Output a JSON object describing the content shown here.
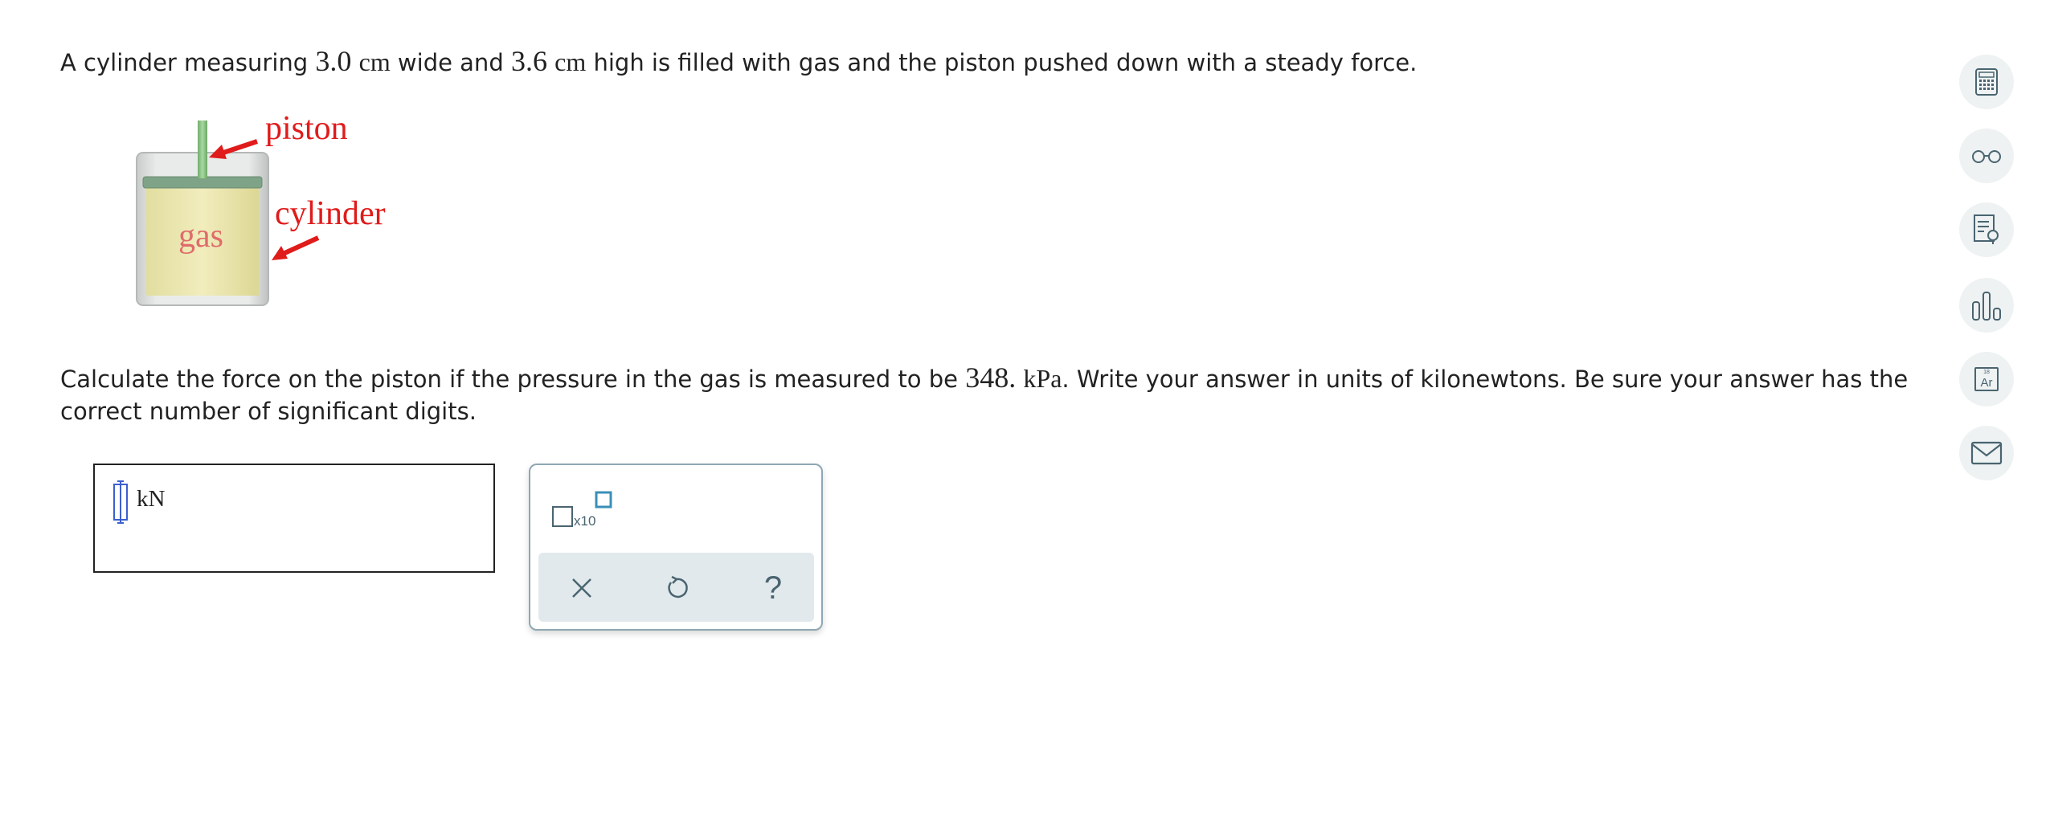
{
  "question": {
    "intro": {
      "part1": "A cylinder measuring ",
      "width_value": "3.0",
      "width_unit": "cm",
      "part2": " wide and ",
      "height_value": "3.6",
      "height_unit": "cm",
      "part3": " high is filled with gas and the piston pushed down with a steady force."
    },
    "prompt": {
      "part1": "Calculate the force on the piston if the pressure in the gas is measured to be ",
      "pressure_value": "348.",
      "pressure_unit": "kPa",
      "part2": ". Write your answer in units of kilonewtons. Be sure your answer has the correct number of significant digits."
    }
  },
  "figure": {
    "label_piston": "piston",
    "label_cylinder": "cylinder",
    "label_gas": "gas"
  },
  "answer": {
    "value": "",
    "unit": "kN"
  },
  "tool_panel": {
    "sci_notation_label": "x10",
    "clear_icon": "close-icon",
    "undo_icon": "undo-icon",
    "help_label": "?"
  },
  "side_toolbar": [
    {
      "name": "calculator",
      "icon": "calculator-icon"
    },
    {
      "name": "reading-glasses",
      "icon": "glasses-icon"
    },
    {
      "name": "notes",
      "icon": "notes-icon"
    },
    {
      "name": "data-chart",
      "icon": "chart-icon"
    },
    {
      "name": "periodic-table",
      "icon": "periodic-table-icon",
      "label_top": "18",
      "label": "Ar"
    },
    {
      "name": "message",
      "icon": "mail-icon"
    }
  ],
  "colors": {
    "accent": "#3a8fb7",
    "label_red": "#e01b1b",
    "icon_gray": "#4a6470",
    "panel_border": "#8fa7b3",
    "panel_bar": "#e1e9ec"
  }
}
